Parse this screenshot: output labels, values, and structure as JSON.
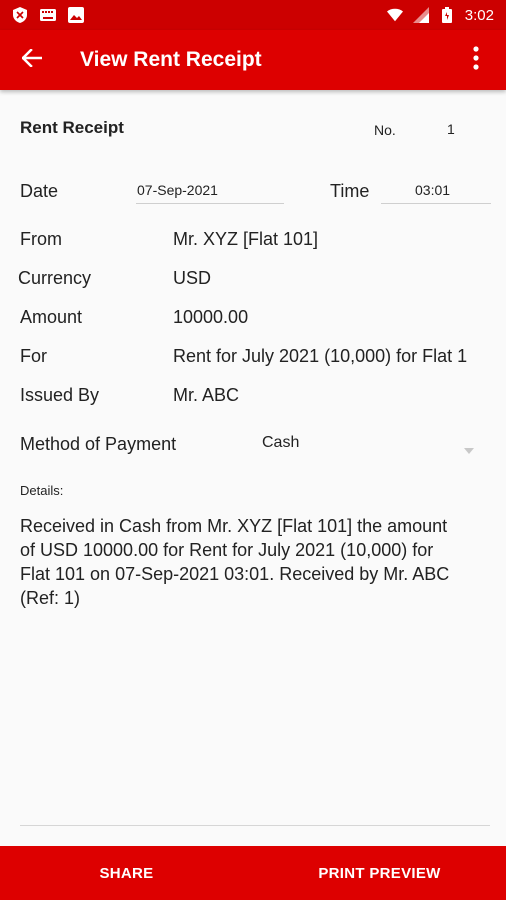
{
  "status_bar": {
    "time": "3:02"
  },
  "app_bar": {
    "title": "View Rent Receipt"
  },
  "receipt": {
    "heading": "Rent Receipt",
    "no_label": "No.",
    "no_value": "1",
    "date_label": "Date",
    "date_value": "07-Sep-2021",
    "time_label": "Time",
    "time_value": "03:01",
    "from_label": "From",
    "from_value": "Mr. XYZ [Flat 101]",
    "currency_label": "Currency",
    "currency_value": "USD",
    "amount_label": "Amount",
    "amount_value": "10000.00",
    "for_label": "For",
    "for_value": "Rent for July 2021 (10,000) for Flat 1",
    "issued_by_label": "Issued By",
    "issued_by_value": "Mr. ABC",
    "method_label": "Method of Payment",
    "method_value": "Cash",
    "details_label": "Details:",
    "details_text": "Received in Cash from Mr. XYZ [Flat 101] the amount of USD 10000.00 for Rent for July 2021 (10,000) for Flat 101 on 07-Sep-2021 03:01. Received by Mr. ABC (Ref: 1)"
  },
  "bottom_bar": {
    "share_label": "SHARE",
    "print_label": "PRINT PREVIEW"
  },
  "colors": {
    "primary": "#dd0000",
    "status": "#cc0000"
  }
}
